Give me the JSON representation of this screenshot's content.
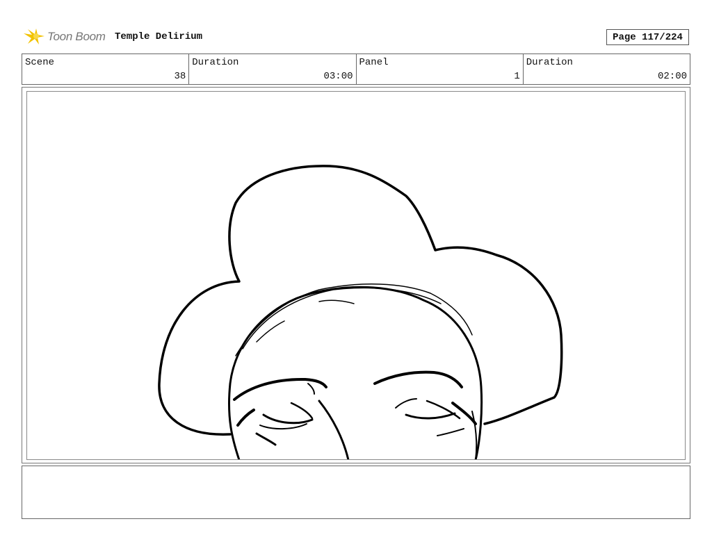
{
  "header": {
    "logo_text": "Toon Boom",
    "project_title": "Temple Delirium",
    "page_label": "Page 117/224"
  },
  "info": {
    "scene_label": "Scene",
    "scene_value": "38",
    "scene_duration_label": "Duration",
    "scene_duration_value": "03:00",
    "panel_label": "Panel",
    "panel_value": "1",
    "panel_duration_label": "Duration",
    "panel_duration_value": "02:00"
  },
  "notes": {
    "text": ""
  }
}
